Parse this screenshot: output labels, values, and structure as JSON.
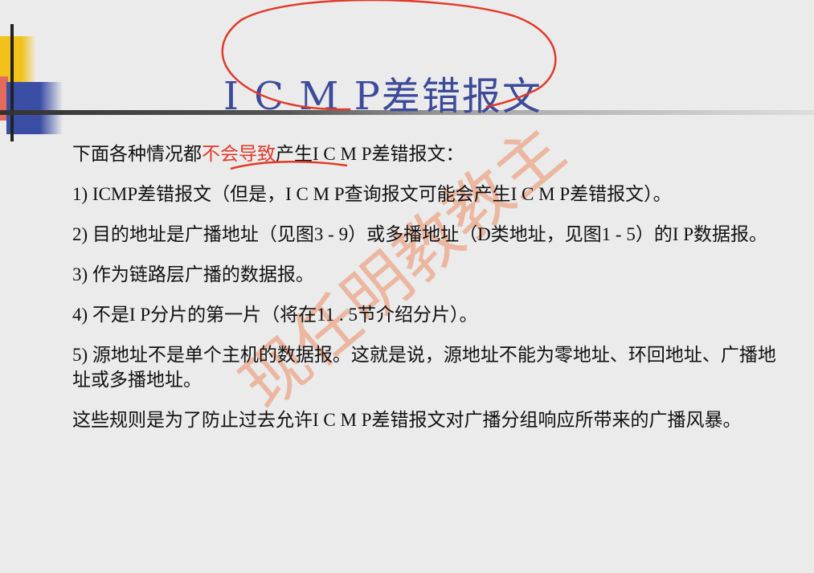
{
  "slide": {
    "title": "I C M P差错报文",
    "intro_pre": "下面各种情况都",
    "intro_highlight": "不会导致",
    "intro_post": "产生I C M P差错报文：",
    "items": [
      "1) ICMP差错报文（但是，I C M P查询报文可能会产生I C M P差错报文）。",
      "2) 目的地址是广播地址（见图3 - 9）或多播地址（D类地址，见图1 - 5）的I P数据报。",
      "3) 作为链路层广播的数据报。",
      "4) 不是I P分片的第一片（将在11 . 5节介绍分片）。",
      "5) 源地址不是单个主机的数据报。这就是说，源地址不能为零地址、环回地址、广播地址或多播地址。"
    ],
    "conclusion": "这些规则是为了防止过去允许I C M P差错报文对广播分组响应所带来的广播风暴。"
  },
  "watermark": "现任明教教主",
  "colors": {
    "title": "#3d4a9a",
    "annotation": "#e03a2a"
  }
}
